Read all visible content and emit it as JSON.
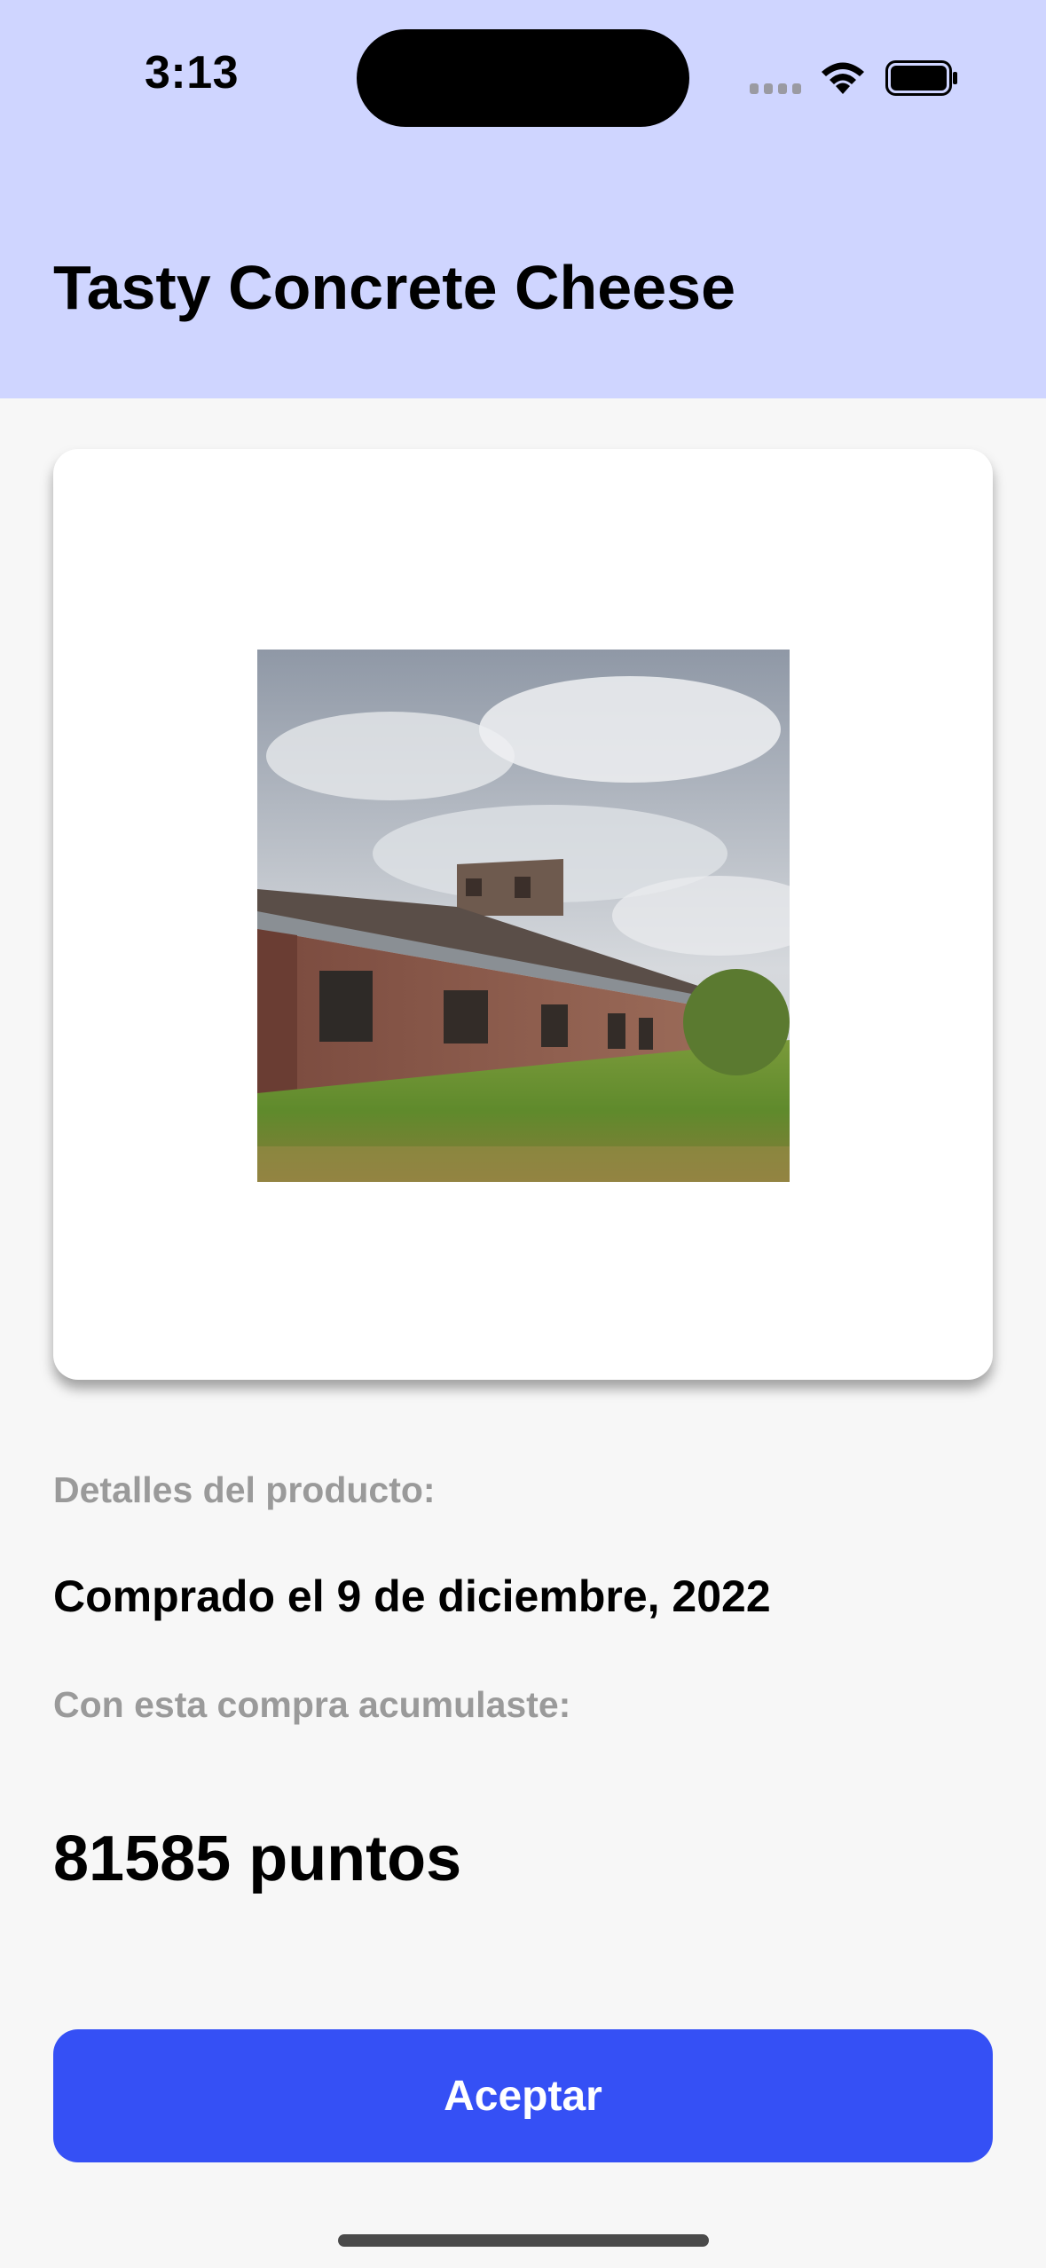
{
  "status_bar": {
    "time": "3:13"
  },
  "header": {
    "title": "Tasty Concrete Cheese",
    "background": "#cfd5ff"
  },
  "product": {
    "image_icon": "product-photo"
  },
  "details": {
    "section_label": "Detalles del producto:",
    "purchase_date": "Comprado el 9 de diciembre, 2022",
    "points_label": "Con esta compra acumulaste:",
    "points_value": "81585 puntos"
  },
  "actions": {
    "accept_label": "Aceptar",
    "accept_color": "#3550f5"
  }
}
